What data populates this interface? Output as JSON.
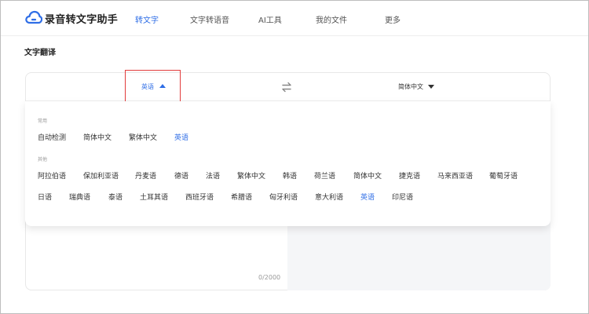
{
  "app": {
    "title": "录音转文字助手"
  },
  "nav": [
    {
      "label": "转文字",
      "active": true
    },
    {
      "label": "文字转语音",
      "active": false
    },
    {
      "label": "AI工具",
      "active": false
    },
    {
      "label": "我的文件",
      "active": false
    },
    {
      "label": "更多",
      "active": false
    }
  ],
  "page": {
    "section_title": "文字翻译"
  },
  "translator": {
    "source_lang": "英语",
    "target_lang": "简体中文",
    "char_count": "0/2000"
  },
  "dropdown": {
    "common_label": "常用",
    "common": [
      {
        "label": "自动检测",
        "selected": false
      },
      {
        "label": "简体中文",
        "selected": false
      },
      {
        "label": "繁体中文",
        "selected": false
      },
      {
        "label": "英语",
        "selected": true
      }
    ],
    "other_label": "其他",
    "other_row1": [
      {
        "label": "阿拉伯语",
        "selected": false
      },
      {
        "label": "保加利亚语",
        "selected": false
      },
      {
        "label": "丹麦语",
        "selected": false
      },
      {
        "label": "德语",
        "selected": false
      },
      {
        "label": "法语",
        "selected": false
      },
      {
        "label": "繁体中文",
        "selected": false
      },
      {
        "label": "韩语",
        "selected": false
      },
      {
        "label": "荷兰语",
        "selected": false
      },
      {
        "label": "简体中文",
        "selected": false
      },
      {
        "label": "捷克语",
        "selected": false
      },
      {
        "label": "马来西亚语",
        "selected": false
      },
      {
        "label": "葡萄牙语",
        "selected": false
      }
    ],
    "other_row2": [
      {
        "label": "日语",
        "selected": false
      },
      {
        "label": "瑞典语",
        "selected": false
      },
      {
        "label": "泰语",
        "selected": false
      },
      {
        "label": "土耳其语",
        "selected": false
      },
      {
        "label": "西班牙语",
        "selected": false
      },
      {
        "label": "希腊语",
        "selected": false
      },
      {
        "label": "匈牙利语",
        "selected": false
      },
      {
        "label": "意大利语",
        "selected": false
      },
      {
        "label": "英语",
        "selected": true
      },
      {
        "label": "印尼语",
        "selected": false
      }
    ]
  },
  "colors": {
    "accent": "#2f6ee6",
    "highlight_border": "#e23b3b"
  }
}
